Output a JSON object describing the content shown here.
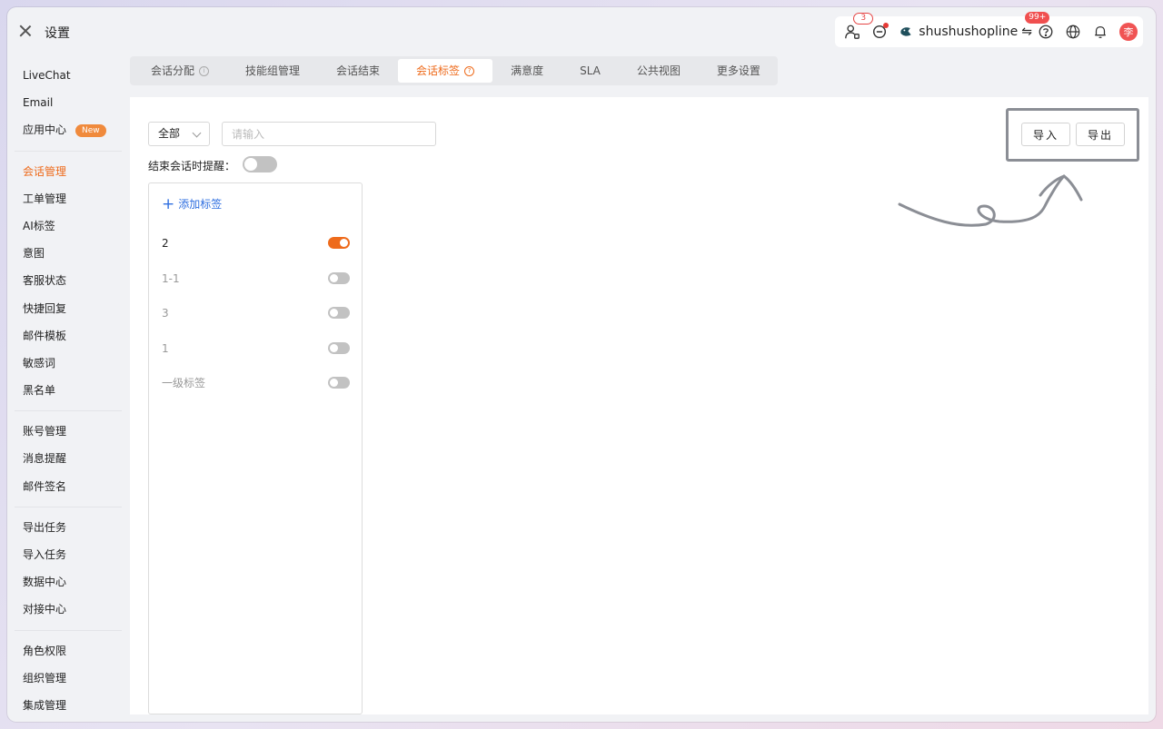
{
  "window": {
    "title": "设置"
  },
  "header": {
    "user_badge": "3",
    "shop_name": "shushushopline",
    "swap_icon": "⇋",
    "swap_badge": "99+",
    "avatar_text": "李"
  },
  "sidebar": {
    "group1": [
      {
        "label": "LiveChat"
      },
      {
        "label": "Email"
      },
      {
        "label": "应用中心",
        "badge": "New"
      }
    ],
    "group2": [
      {
        "label": "会话管理",
        "active": true
      },
      {
        "label": "工单管理"
      },
      {
        "label": "AI标签"
      },
      {
        "label": "意图"
      },
      {
        "label": "客服状态"
      },
      {
        "label": "快捷回复"
      },
      {
        "label": "邮件模板"
      },
      {
        "label": "敏感词"
      },
      {
        "label": "黑名单"
      }
    ],
    "group3": [
      {
        "label": "账号管理"
      },
      {
        "label": "消息提醒"
      },
      {
        "label": "邮件签名"
      }
    ],
    "group4": [
      {
        "label": "导出任务"
      },
      {
        "label": "导入任务"
      },
      {
        "label": "数据中心"
      },
      {
        "label": "对接中心"
      }
    ],
    "group5": [
      {
        "label": "角色权限"
      },
      {
        "label": "组织管理"
      },
      {
        "label": "集成管理"
      }
    ]
  },
  "tabs": [
    {
      "label": "会话分配",
      "info": "i"
    },
    {
      "label": "技能组管理"
    },
    {
      "label": "会话结束"
    },
    {
      "label": "会话标签",
      "info": "?",
      "active": true
    },
    {
      "label": "满意度"
    },
    {
      "label": "SLA"
    },
    {
      "label": "公共视图"
    },
    {
      "label": "更多设置"
    }
  ],
  "filter": {
    "select_value": "全部",
    "search_placeholder": "请输入"
  },
  "reminder": {
    "label": "结束会话时提醒：",
    "enabled": false
  },
  "tag_panel": {
    "add_label": "添加标签",
    "tags": [
      {
        "name": "2",
        "enabled": true
      },
      {
        "name": "1-1",
        "enabled": false
      },
      {
        "name": "3",
        "enabled": false
      },
      {
        "name": "1",
        "enabled": false
      },
      {
        "name": "一级标签",
        "enabled": false
      }
    ]
  },
  "actions": {
    "import_label": "导入",
    "export_label": "导出"
  },
  "colors": {
    "accent": "#ee6b1c",
    "link": "#2f6fe0",
    "badge_red": "#f04f4f"
  }
}
